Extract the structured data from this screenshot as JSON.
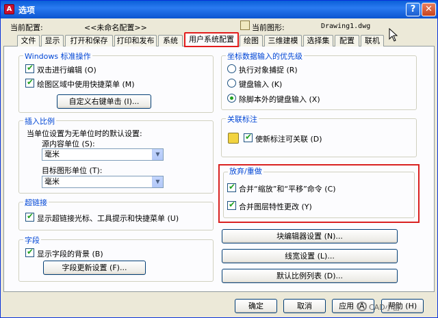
{
  "window": {
    "title": "选项",
    "help": "?",
    "close": "✕"
  },
  "header": {
    "profile_label": "当前配置:",
    "profile_value": "<<未命名配置>>",
    "drawing_label": "当前图形:",
    "drawing_value": "Drawing1.dwg"
  },
  "tabs": [
    "文件",
    "显示",
    "打开和保存",
    "打印和发布",
    "系统",
    "用户系统配置",
    "绘图",
    "三维建模",
    "选择集",
    "配置",
    "联机"
  ],
  "groups": {
    "windows": {
      "title": "Windows 标准操作",
      "double_click": "双击进行编辑 (O)",
      "shortcut_menu": "绘图区域中使用快捷菜单 (M)",
      "custom_right_click": "自定义右键单击 (I)..."
    },
    "insert_scale": {
      "title": "插入比例",
      "desc": "当单位设置为无单位时的默认设置:",
      "source_label": "源内容单位 (S):",
      "source_value": "毫米",
      "target_label": "目标图形单位 (T):",
      "target_value": "毫米"
    },
    "hyperlink": {
      "title": "超链接",
      "show_cursor": "显示超链接光标、工具提示和快捷菜单 (U)"
    },
    "fields": {
      "title": "字段",
      "show_background": "显示字段的背景 (B)",
      "update_settings": "字段更新设置 (F)..."
    },
    "coord_priority": {
      "title": "坐标数据输入的优先级",
      "options": [
        "执行对象捕捉 (R)",
        "键盘输入 (K)",
        "除脚本外的键盘输入 (X)"
      ],
      "selected": "除脚本外的键盘输入 (X)"
    },
    "assoc_dim": {
      "title": "关联标注",
      "make_associative": "使新标注可关联 (D)"
    },
    "undo_redo": {
      "title": "放弃/重做",
      "combine_zoom_pan": "合并“缩放”和“平移”命令 (C)",
      "combine_layer": "合并图层特性更改 (Y)"
    }
  },
  "buttons": {
    "block_editor": "块编辑器设置 (N)...",
    "lineweight": "线宽设置 (L)...",
    "scale_list": "默认比例列表 (D)..."
  },
  "footer": {
    "ok": "确定",
    "cancel": "取消",
    "apply": "应用 (A)",
    "help": "帮助 (H)"
  },
  "watermark": "CAD小苗",
  "colors": {
    "group_title": "#0046d5",
    "highlight": "#d9201f",
    "titlebar": "#0a5fd8"
  }
}
